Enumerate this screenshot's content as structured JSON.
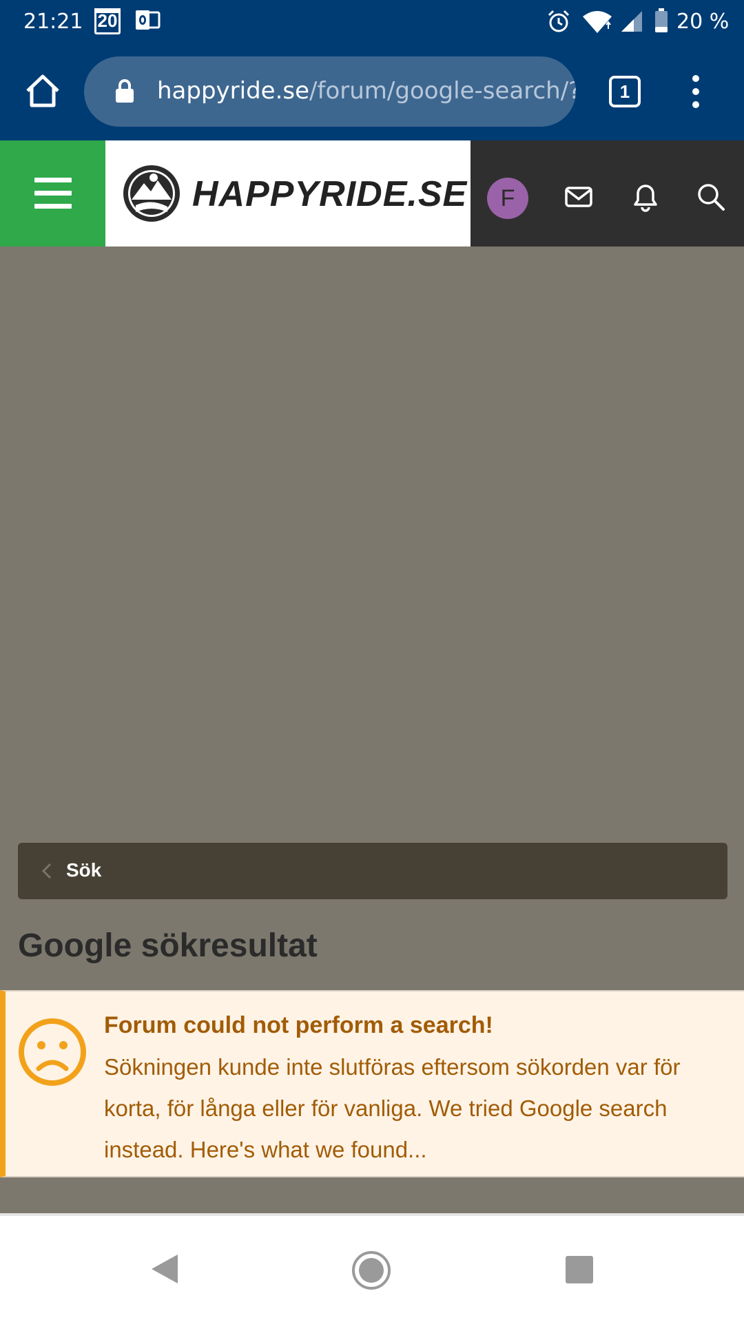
{
  "status_bar": {
    "time": "21:21",
    "calendar_day": "20",
    "battery_percent": "20 %"
  },
  "browser": {
    "url_domain": "happyride.se",
    "url_path": "/forum/google-search/?q",
    "tab_count": "1"
  },
  "site_header": {
    "logo_text": "HAPPYRIDE.SE",
    "avatar_letter": "F"
  },
  "breadcrumb": {
    "label": "Sök"
  },
  "page": {
    "title": "Google sökresultat"
  },
  "notice": {
    "title": "Forum could not perform a search!",
    "body": "Sökningen kunde inte slutföras eftersom sökorden var för korta, för långa eller för vanliga. We tried Google search instead. Here's what we found..."
  },
  "colors": {
    "status_bar_bg": "#003c74",
    "url_pill_bg": "#3e6790",
    "menu_green": "#2fa94a",
    "header_dark": "#2f2f2f",
    "avatar_purple": "#9a62a8",
    "page_bg": "#7d786d",
    "breadcrumb_bg": "#474135",
    "notice_bg": "#fff3e6",
    "notice_accent": "#f2a21a",
    "notice_text": "#a15c06"
  }
}
